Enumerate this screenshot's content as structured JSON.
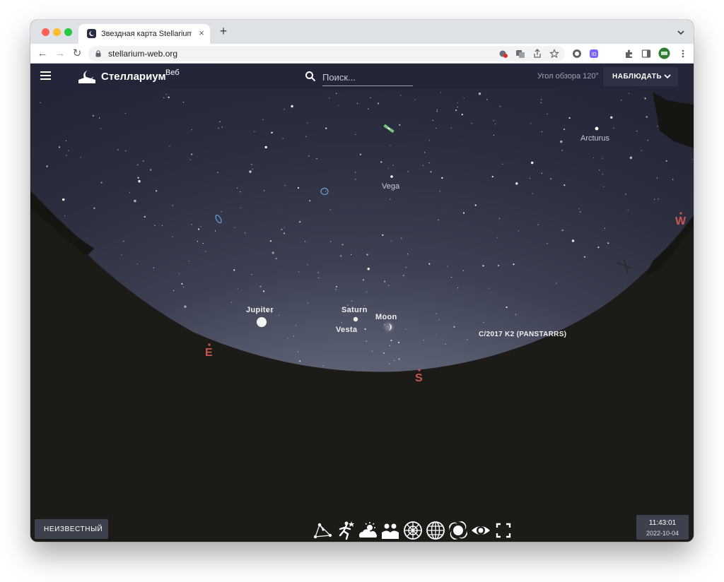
{
  "browser": {
    "tab_title": "Звездная карта Stellarium Web",
    "url": "stellarium-web.org",
    "tab_close": "×",
    "new_tab": "+",
    "back": "←",
    "forward": "→",
    "reload": "↻"
  },
  "app": {
    "brand": "Стеллариум",
    "brand_sup": "Веб",
    "search_placeholder": "Поиск...",
    "fov_text": "Угол обзора 120°",
    "observe_label": "НАБЛЮДАТЬ",
    "location_button": "НЕИЗВЕСТНЫЙ",
    "time": "11:43:01",
    "date": "2022-10-04"
  },
  "sky": {
    "labels": {
      "arcturus": "Arcturus",
      "vega": "Vega",
      "jupiter": "Jupiter",
      "saturn": "Saturn",
      "vesta": "Vesta",
      "moon": "Moon",
      "comet": "C/2017 K2 (PANSTARRS)"
    },
    "cardinals": {
      "east": "E",
      "south": "S",
      "west": "W"
    }
  },
  "tools": [
    "constellation-lines-icon",
    "constellation-art-icon",
    "atmosphere-icon",
    "landscape-icon",
    "azimuthal-grid-icon",
    "equatorial-grid-icon",
    "deep-sky-objects-icon",
    "night-mode-icon",
    "fullscreen-icon"
  ],
  "colors": {
    "appbar": "#242638",
    "sky_top": "#262a3a",
    "sky_horizon": "#4f5466",
    "ground": "#1d1c18",
    "cardinal": "#c9574f"
  }
}
